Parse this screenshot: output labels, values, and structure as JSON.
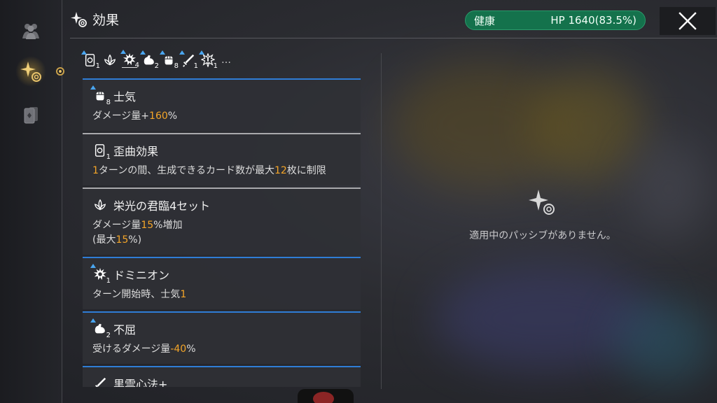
{
  "header": {
    "title": "効果",
    "icon": "sparkle-swirl-icon"
  },
  "hp": {
    "status": "健康",
    "value": "HP 1640(83.5%)",
    "color": "#14724c",
    "fill_percent": 83.5
  },
  "close": {
    "icon": "close-icon"
  },
  "sidebar": {
    "items": [
      {
        "icon": "team-icon"
      },
      {
        "icon": "sparkle-swirl-icon",
        "active": true
      },
      {
        "icon": "cards-icon"
      }
    ]
  },
  "effect_icons": [
    {
      "icon": "distortion-card-icon",
      "count": "1"
    },
    {
      "icon": "glory-lotus-icon",
      "count": ""
    },
    {
      "icon": "dominion-burst-icon",
      "count": "4"
    },
    {
      "icon": "unyielding-muscle-icon",
      "count": "2"
    },
    {
      "icon": "morale-fist-icon",
      "count": "8"
    },
    {
      "icon": "sword-icon",
      "count": "1"
    },
    {
      "icon": "warning-burst-icon",
      "count": "1"
    }
  ],
  "more": "…",
  "effects": [
    {
      "name": "士気",
      "icon": "morale-fist-icon",
      "count": "8",
      "desc": [
        {
          "t": "ダメージ量+"
        },
        {
          "t": "160",
          "h": true
        },
        {
          "t": "%"
        }
      ]
    },
    {
      "name": "歪曲効果",
      "icon": "distortion-card-icon",
      "count": "1",
      "desc": [
        {
          "t": "1",
          "h": true
        },
        {
          "t": "ターンの間、生成できるカード数が最大"
        },
        {
          "t": "12",
          "h": true
        },
        {
          "t": "枚に制限"
        }
      ]
    },
    {
      "name": "栄光の君臨4セット",
      "icon": "glory-lotus-icon",
      "count": "",
      "desc": [
        {
          "t": "ダメージ量"
        },
        {
          "t": "15",
          "h": true
        },
        {
          "t": "%増加"
        }
      ],
      "desc2": [
        {
          "t": "(最大"
        },
        {
          "t": "15",
          "h": true
        },
        {
          "t": "%)"
        }
      ]
    },
    {
      "name": "ドミニオン",
      "icon": "dominion-burst-icon",
      "count": "1",
      "desc": [
        {
          "t": "ターン開始時、士気"
        },
        {
          "t": "1",
          "h": true
        }
      ]
    },
    {
      "name": "不屈",
      "icon": "unyielding-muscle-icon",
      "count": "2",
      "desc": [
        {
          "t": "受けるダメージ量"
        },
        {
          "t": "-40",
          "h": true
        },
        {
          "t": "%"
        }
      ]
    },
    {
      "name": "黒雲心法+",
      "icon": "sword-icon",
      "count": "",
      "desc": []
    }
  ],
  "passive": {
    "empty_text": "適用中のパッシブがありません。",
    "icon": "sparkle-swirl-icon"
  },
  "colors": {
    "accent_gold": "#e7c26a",
    "highlight": "#f4a528",
    "blue_border": "#2f7dd6",
    "hp_green": "#14724c"
  }
}
